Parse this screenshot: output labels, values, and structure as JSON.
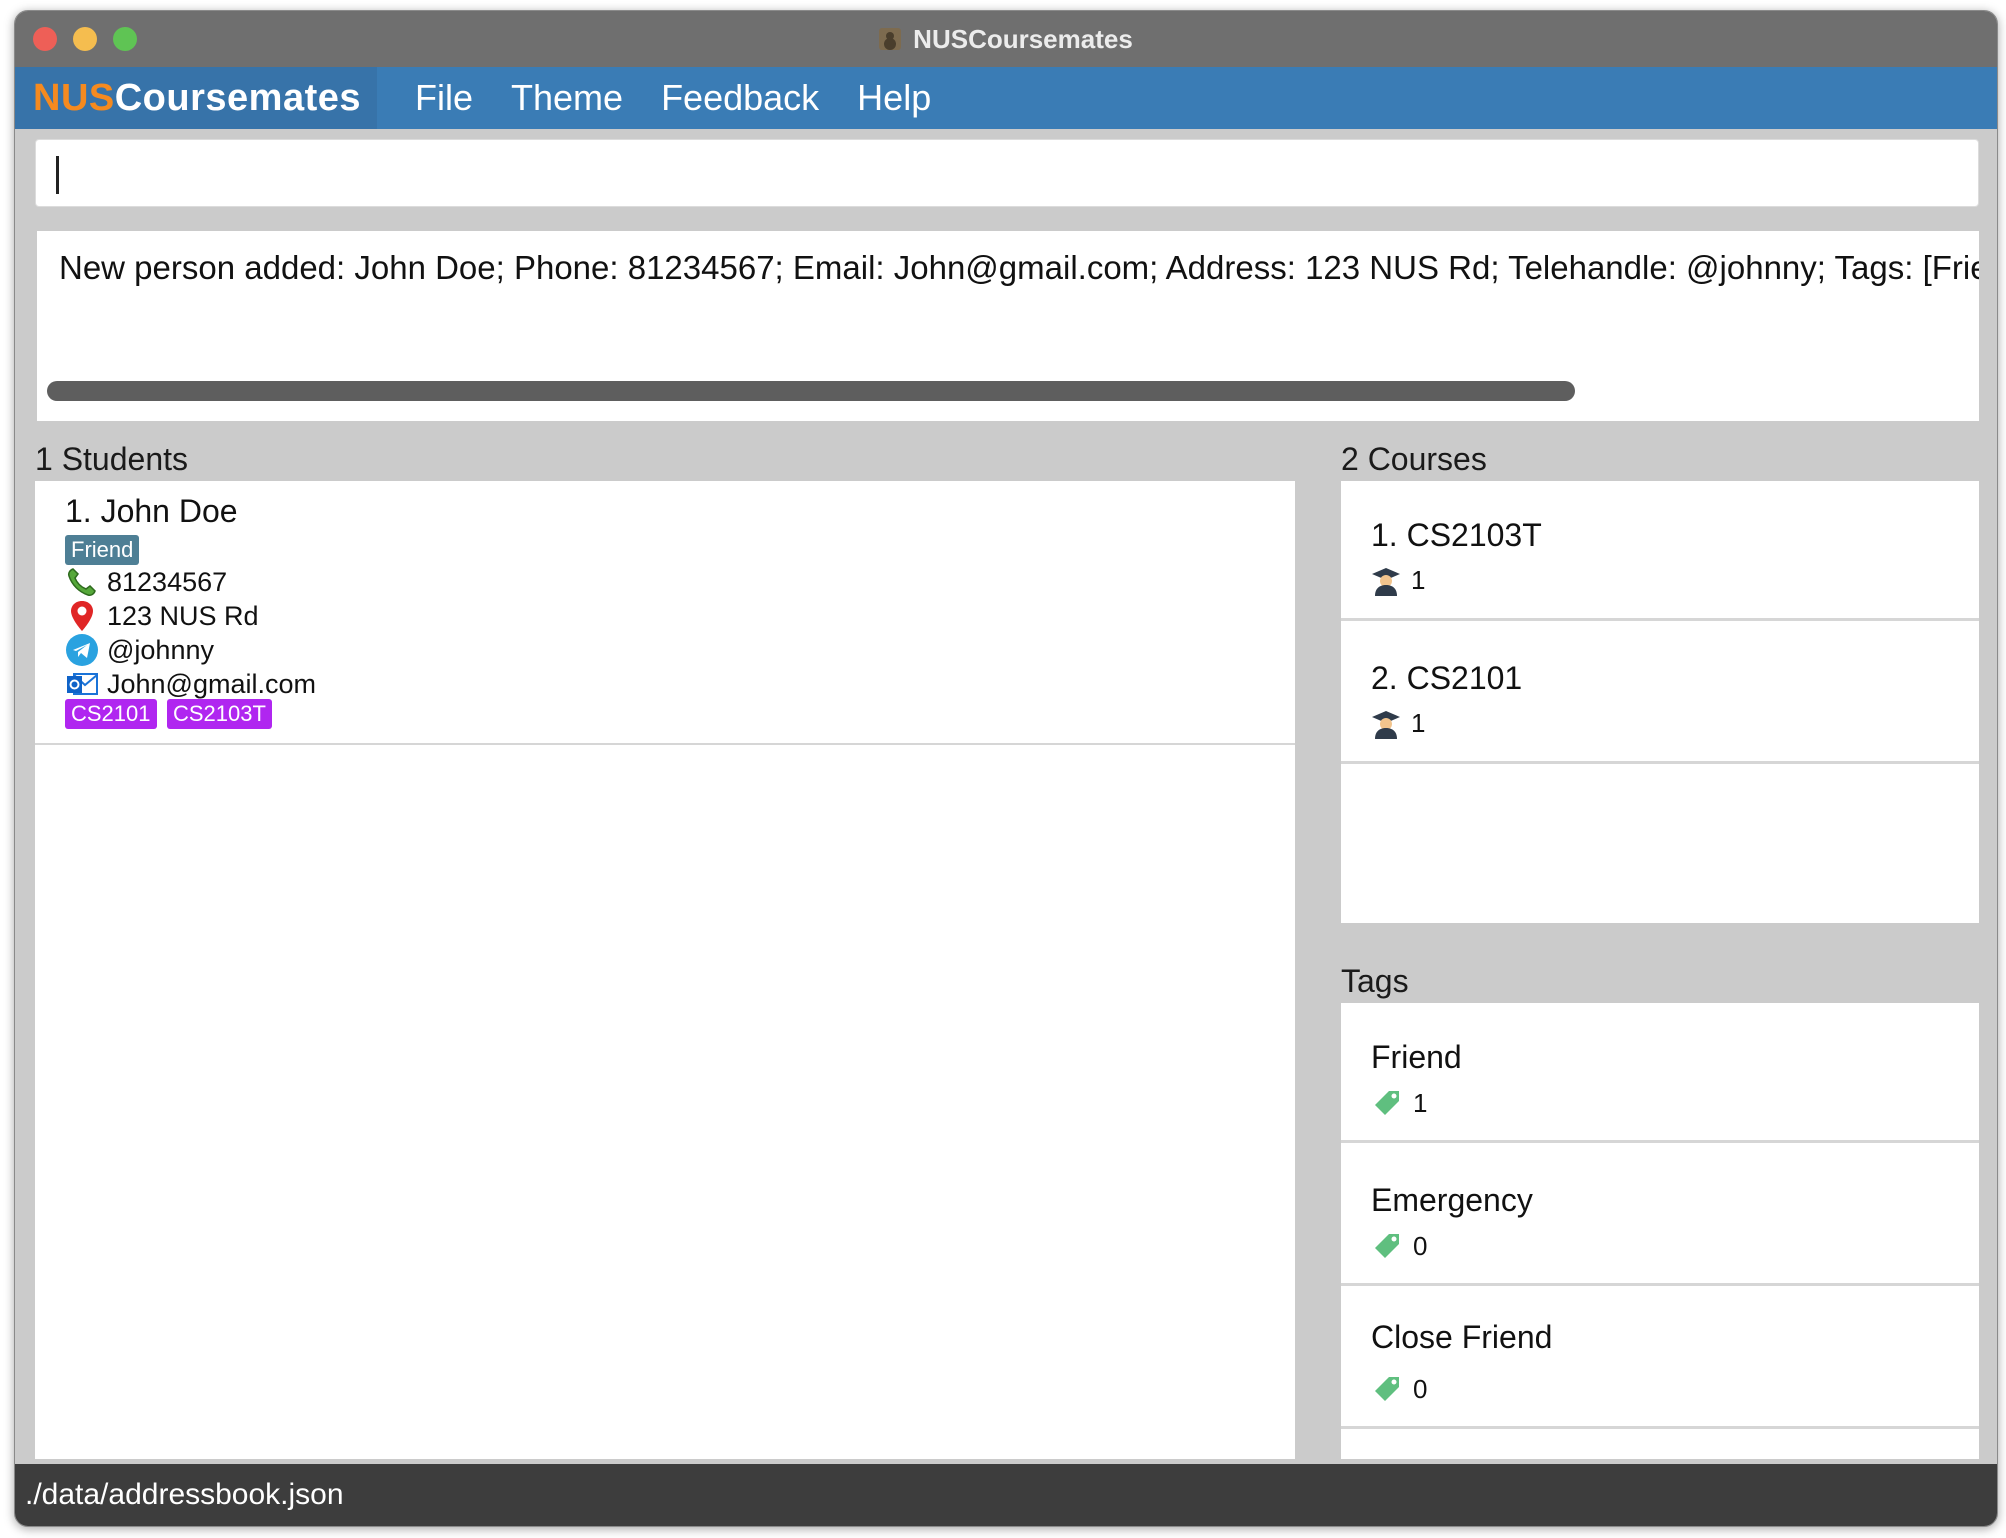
{
  "window": {
    "title": "NUSCoursemates"
  },
  "menubar": {
    "brand_nus": "NUS",
    "brand_rest": "Coursemates",
    "items": [
      "File",
      "Theme",
      "Feedback",
      "Help"
    ]
  },
  "command": {
    "value": ""
  },
  "result": {
    "text": "New person added: John Doe; Phone: 81234567; Email: John@gmail.com; Address: 123 NUS Rd; Telehandle: @johnny; Tags: [Friend]"
  },
  "students": {
    "header": "1 Students",
    "list": [
      {
        "name": "1.  John Doe",
        "tags": [
          "Friend"
        ],
        "phone": "81234567",
        "address": "123 NUS Rd",
        "telehandle": "@johnny",
        "email": "John@gmail.com",
        "courses": [
          "CS2101",
          "CS2103T"
        ]
      }
    ]
  },
  "courses": {
    "header": "2 Courses",
    "list": [
      {
        "title": "1.  CS2103T",
        "count": "1"
      },
      {
        "title": "2.  CS2101",
        "count": "1"
      }
    ]
  },
  "tags": {
    "header": "Tags",
    "list": [
      {
        "title": "Friend",
        "count": "1"
      },
      {
        "title": "Emergency",
        "count": "0"
      },
      {
        "title": "Close Friend",
        "count": "0"
      }
    ]
  },
  "status": {
    "path": "./data/addressbook.json"
  },
  "colors": {
    "menubar": "#3a7cb5",
    "brand_orange": "#f58a1f",
    "tag_friend": "#4e7f95",
    "tag_course": "#b026f0"
  }
}
